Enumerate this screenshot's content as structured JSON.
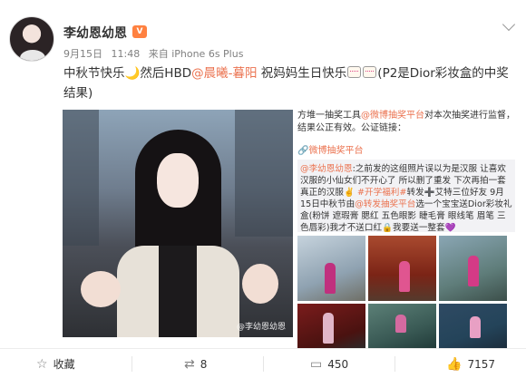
{
  "post": {
    "author": "李幼恩幼恩",
    "date": "9月15日",
    "time": "11:48",
    "source": "来自 iPhone 6s Plus",
    "text_1": "中秋节快乐",
    "text_2": "然后HBD",
    "mention": "@晨曦-暮阳",
    "text_3": "祝妈妈生日快乐",
    "text_4": "(P2是Dior彩妆盒的中奖结果)",
    "photo_watermark": "@李幼恩幼恩"
  },
  "lottery": {
    "line_1_a": "方堆一抽奖工具",
    "line_1_link": "@微博抽奖平台",
    "line_1_b": "对本次抽奖进行监督，结果公正有效。公证链接：",
    "line_2_link": "微博抽奖平台",
    "quote_author": "@李幼恩幼恩",
    "quote_body_1": ":之前发的这组照片误以为是汉服 让喜欢汉服的小仙女们不开心了 所以删了重发 下次再拍一套真正的汉服✌️",
    "quote_tag": "#开学福利#",
    "quote_body_2": "转发➕艾特三位好友 9月15日中秋节由",
    "quote_platform": "@转发抽奖平台",
    "quote_body_3": "选一个宝宝送Dior彩妆礼盒(粉饼 遮瑕膏 腮红 五色眼影 睫毛膏 眼线笔 眉笔 三色唇彩)我才不送口红🔒我要送一整套💜"
  },
  "actions": {
    "favorite": "收藏",
    "repost": "8",
    "comment": "450",
    "like": "7157"
  },
  "colors": {
    "link": "#eb7350",
    "vip": "#ff8140"
  }
}
